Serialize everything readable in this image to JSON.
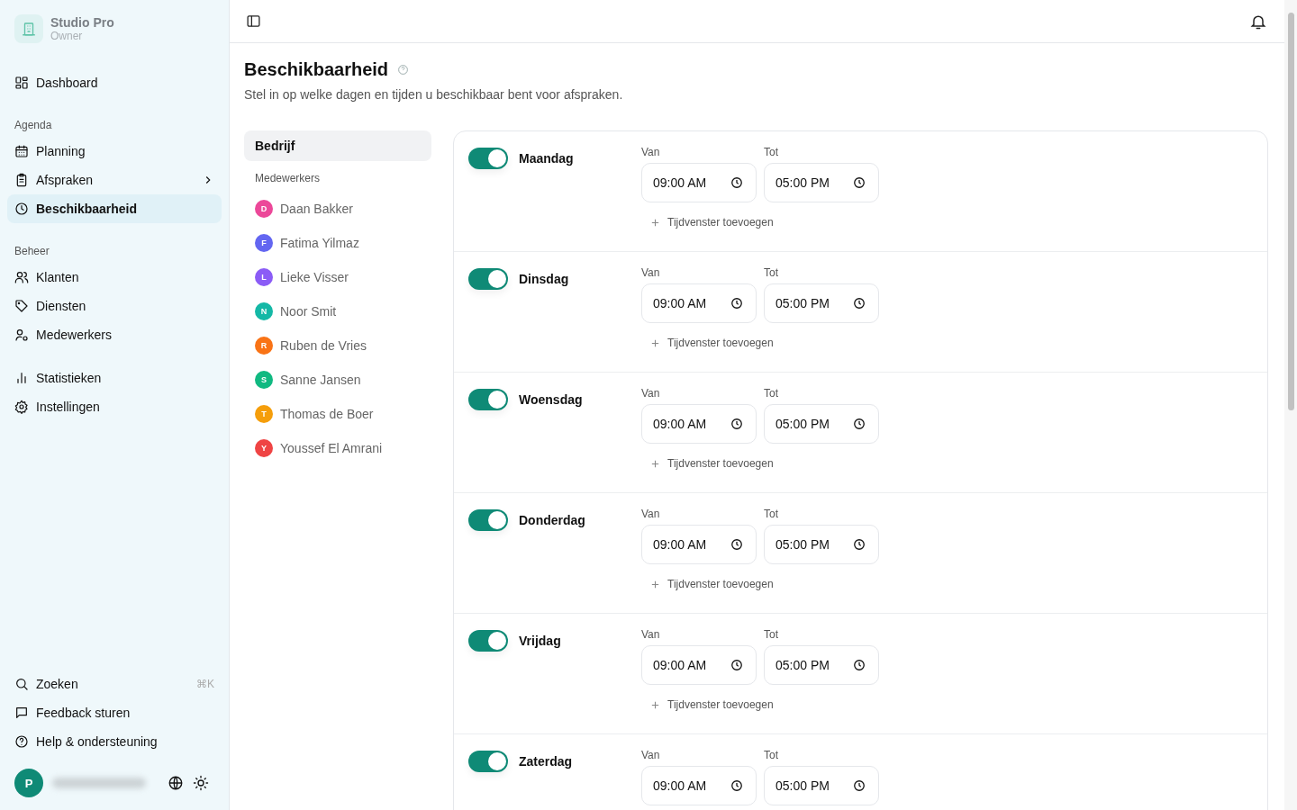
{
  "workspace": {
    "name": "Studio Pro",
    "role": "Owner"
  },
  "sidebar": {
    "top": [
      {
        "label": "Dashboard",
        "kind": "grid",
        "selected": false
      }
    ],
    "groups": [
      {
        "title": "Agenda",
        "items": [
          {
            "label": "Planning",
            "kind": "calendar",
            "selected": false
          },
          {
            "label": "Afspraken",
            "kind": "clipboard",
            "selected": false,
            "has_submenu": true
          },
          {
            "label": "Beschikbaarheid",
            "kind": "clock",
            "selected": true
          }
        ]
      },
      {
        "title": "Beheer",
        "items": [
          {
            "label": "Klanten",
            "kind": "users",
            "selected": false
          },
          {
            "label": "Diensten",
            "kind": "tag",
            "selected": false
          },
          {
            "label": "Medewerkers",
            "kind": "usercog",
            "selected": false
          }
        ]
      },
      {
        "items": [
          {
            "label": "Statistieken",
            "kind": "chart",
            "selected": false
          },
          {
            "label": "Instellingen",
            "kind": "gear",
            "selected": false
          }
        ]
      }
    ],
    "bottom": [
      {
        "label": "Zoeken",
        "kind": "search",
        "shortcut": "⌘K"
      },
      {
        "label": "Feedback sturen",
        "kind": "message"
      },
      {
        "label": "Help & ondersteuning",
        "kind": "help"
      }
    ],
    "user": {
      "initial": "P"
    }
  },
  "page": {
    "title": "Beschikbaarheid",
    "subtitle": "Stel in op welke dagen en tijden u beschikbaar bent voor afspraken."
  },
  "scope": {
    "company": {
      "label": "Bedrijf",
      "selected": true
    },
    "staff_title": "Medewerkers",
    "staff": [
      {
        "initial": "D",
        "name": "Daan Bakker",
        "color": "#ec4899",
        "selected": false
      },
      {
        "initial": "F",
        "name": "Fatima Yilmaz",
        "color": "#6366f1",
        "selected": false
      },
      {
        "initial": "L",
        "name": "Lieke Visser",
        "color": "#8b5cf6",
        "selected": false
      },
      {
        "initial": "N",
        "name": "Noor Smit",
        "color": "#14b8a6",
        "selected": false
      },
      {
        "initial": "R",
        "name": "Ruben de Vries",
        "color": "#f97316",
        "selected": false
      },
      {
        "initial": "S",
        "name": "Sanne Jansen",
        "color": "#10b981",
        "selected": false
      },
      {
        "initial": "T",
        "name": "Thomas de Boer",
        "color": "#f59e0b",
        "selected": false
      },
      {
        "initial": "Y",
        "name": "Youssef El Amrani",
        "color": "#ef4444",
        "selected": false
      }
    ]
  },
  "days": [
    {
      "name": "Maandag",
      "on": true,
      "from_label": "Van",
      "from": "09:00 AM",
      "to_label": "Tot",
      "to": "05:00 PM",
      "add": "Tijdvenster toevoegen"
    },
    {
      "name": "Dinsdag",
      "on": true,
      "from_label": "Van",
      "from": "09:00 AM",
      "to_label": "Tot",
      "to": "05:00 PM",
      "add": "Tijdvenster toevoegen"
    },
    {
      "name": "Woensdag",
      "on": true,
      "from_label": "Van",
      "from": "09:00 AM",
      "to_label": "Tot",
      "to": "05:00 PM",
      "add": "Tijdvenster toevoegen"
    },
    {
      "name": "Donderdag",
      "on": true,
      "from_label": "Van",
      "from": "09:00 AM",
      "to_label": "Tot",
      "to": "05:00 PM",
      "add": "Tijdvenster toevoegen"
    },
    {
      "name": "Vrijdag",
      "on": true,
      "from_label": "Van",
      "from": "09:00 AM",
      "to_label": "Tot",
      "to": "05:00 PM",
      "add": "Tijdvenster toevoegen"
    },
    {
      "name": "Zaterdag",
      "on": true,
      "from_label": "Van",
      "from": "09:00 AM",
      "to_label": "Tot",
      "to": "05:00 PM"
    }
  ]
}
